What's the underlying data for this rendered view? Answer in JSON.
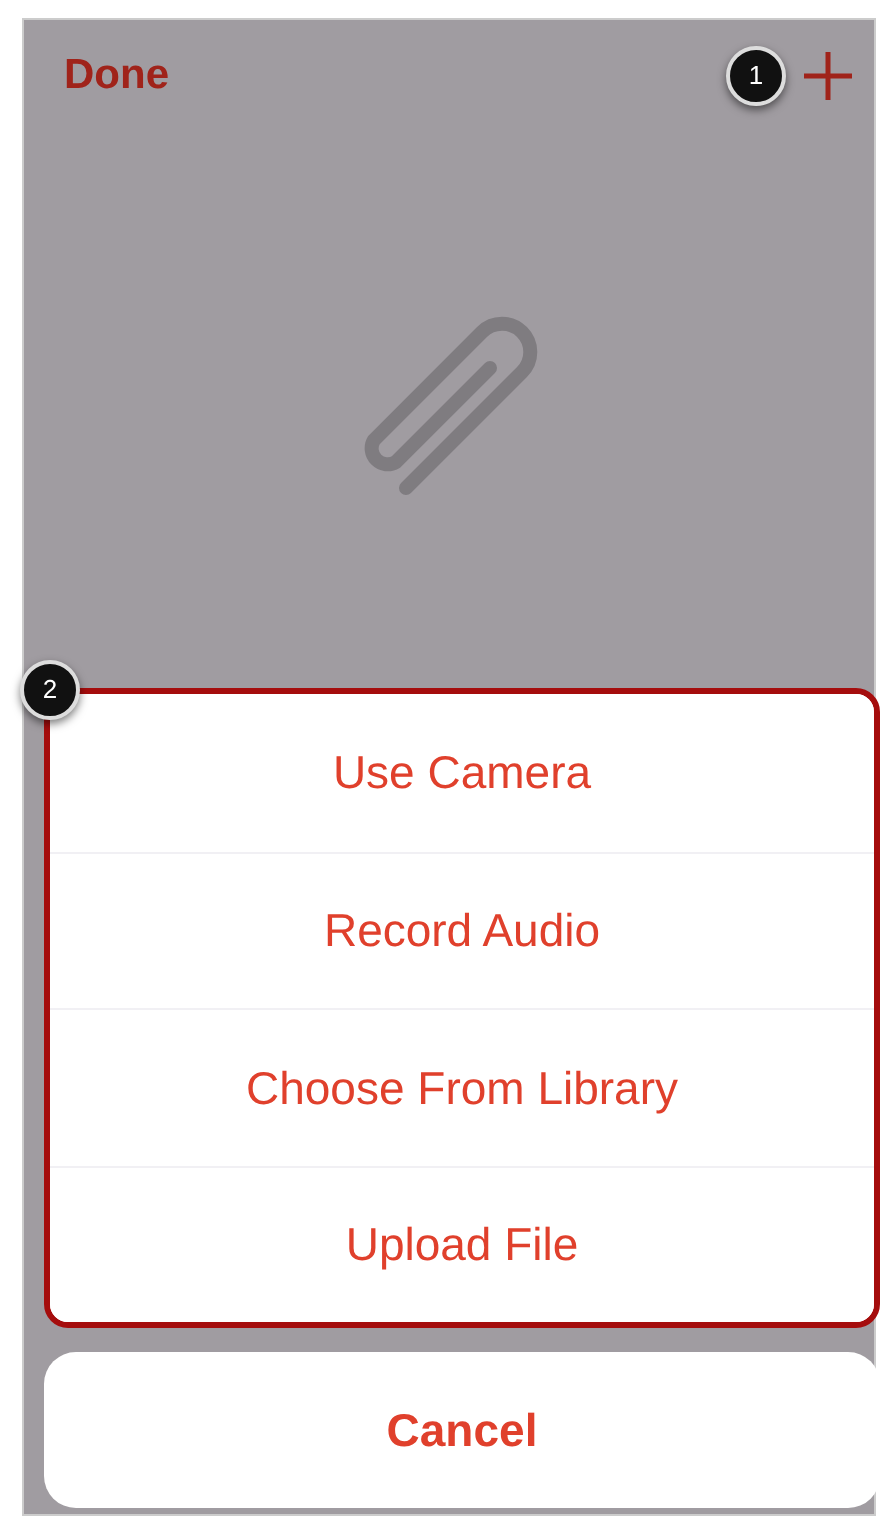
{
  "nav": {
    "done": "Done"
  },
  "callouts": [
    {
      "number": "1"
    },
    {
      "number": "2"
    }
  ],
  "action_sheet": {
    "highlighted": true,
    "items": [
      "Use Camera",
      "Record Audio",
      "Choose From Library",
      "Upload File"
    ]
  },
  "cancel": "Cancel"
}
